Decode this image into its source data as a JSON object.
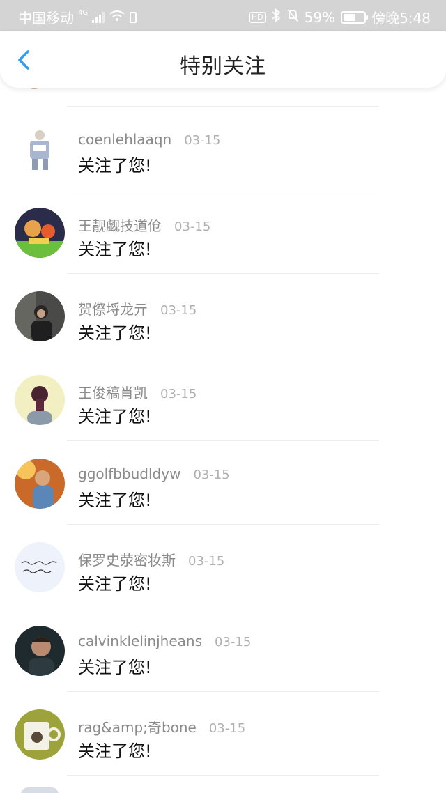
{
  "status_bar": {
    "carrier": "中国移动",
    "network": "4G",
    "battery_percent": "59%",
    "battery_level": 0.59,
    "time": "傍晚5:48"
  },
  "nav": {
    "title": "特别关注",
    "back_icon": "chevron-left-icon"
  },
  "colors": {
    "accent": "#2d9cf5",
    "status_bar_bg": "#d4d4d4"
  },
  "items": [
    {
      "name": "coenlehlaaqn",
      "date": "03-15",
      "message": "关注了您!",
      "avatar": "cartoon-figure"
    },
    {
      "name": "王靓觑技道伧",
      "date": "03-15",
      "message": "关注了您!",
      "avatar": "cartoon-scene"
    },
    {
      "name": "贺傺埒龙亓",
      "date": "03-15",
      "message": "关注了您!",
      "avatar": "person-photo"
    },
    {
      "name": "王俊稿肖凯",
      "date": "03-15",
      "message": "关注了您!",
      "avatar": "woman-back"
    },
    {
      "name": "ggolfbbudldyw",
      "date": "03-15",
      "message": "关注了您!",
      "avatar": "man-sunlight"
    },
    {
      "name": "保罗史荥密妆斯",
      "date": "03-15",
      "message": "关注了您!",
      "avatar": "handwriting"
    },
    {
      "name": "calvinklelinjheans",
      "date": "03-15",
      "message": "关注了您!",
      "avatar": "man-portrait"
    },
    {
      "name": "rag&amp;奇bone",
      "date": "03-15",
      "message": "关注了您!",
      "avatar": "coffee-mug"
    }
  ]
}
